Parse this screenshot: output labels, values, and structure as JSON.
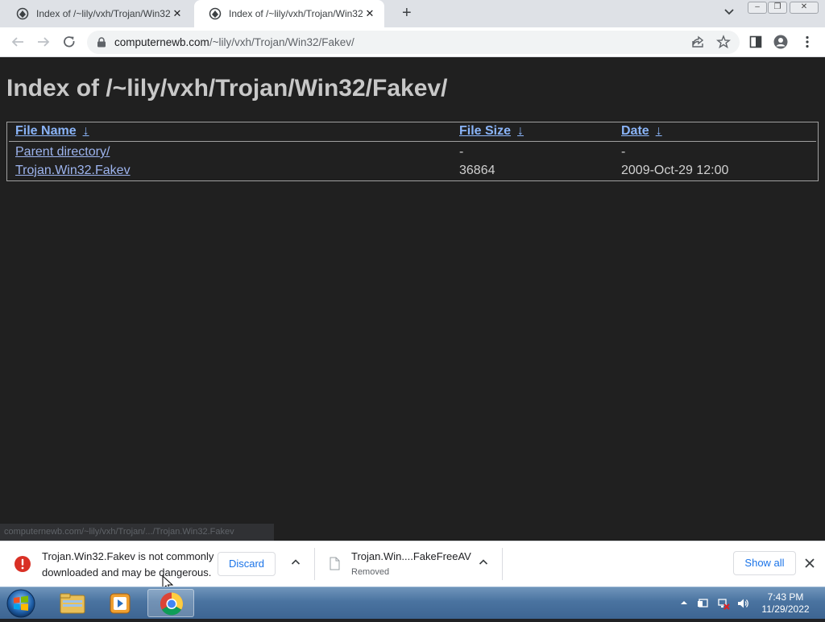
{
  "browser": {
    "tabs": [
      {
        "title": "Index of /~lily/vxh/Trojan/Win32",
        "active": false
      },
      {
        "title": "Index of /~lily/vxh/Trojan/Win32",
        "active": true
      }
    ],
    "url_host": "computernewb.com",
    "url_path": "/~lily/vxh/Trojan/Win32/Fakev/"
  },
  "page": {
    "heading": "Index of /~lily/vxh/Trojan/Win32/Fakev/",
    "columns": {
      "name": "File Name",
      "size": "File Size",
      "date": "Date",
      "sort_arrow": "↓"
    },
    "rows": [
      {
        "name": "Parent directory/",
        "size": "-",
        "date": "-"
      },
      {
        "name": "Trojan.Win32.Fakev",
        "size": "36864",
        "date": "2009-Oct-29 12:00"
      }
    ],
    "status_url": "computernewb.com/~lily/vxh/Trojan/.../Trojan.Win32.Fakev"
  },
  "downloads": {
    "warning_text": "Trojan.Win32.Fakev is not commonly downloaded and may be dangerous.",
    "discard_label": "Discard",
    "item_name": "Trojan.Win....FakeFreeAV",
    "item_status": "Removed",
    "show_all_label": "Show all"
  },
  "taskbar": {
    "time": "7:43 PM",
    "date": "11/29/2022"
  },
  "colors": {
    "page_bg": "#202020",
    "link": "#8ab4f8",
    "warning": "#d93025",
    "accent": "#1a73e8"
  }
}
